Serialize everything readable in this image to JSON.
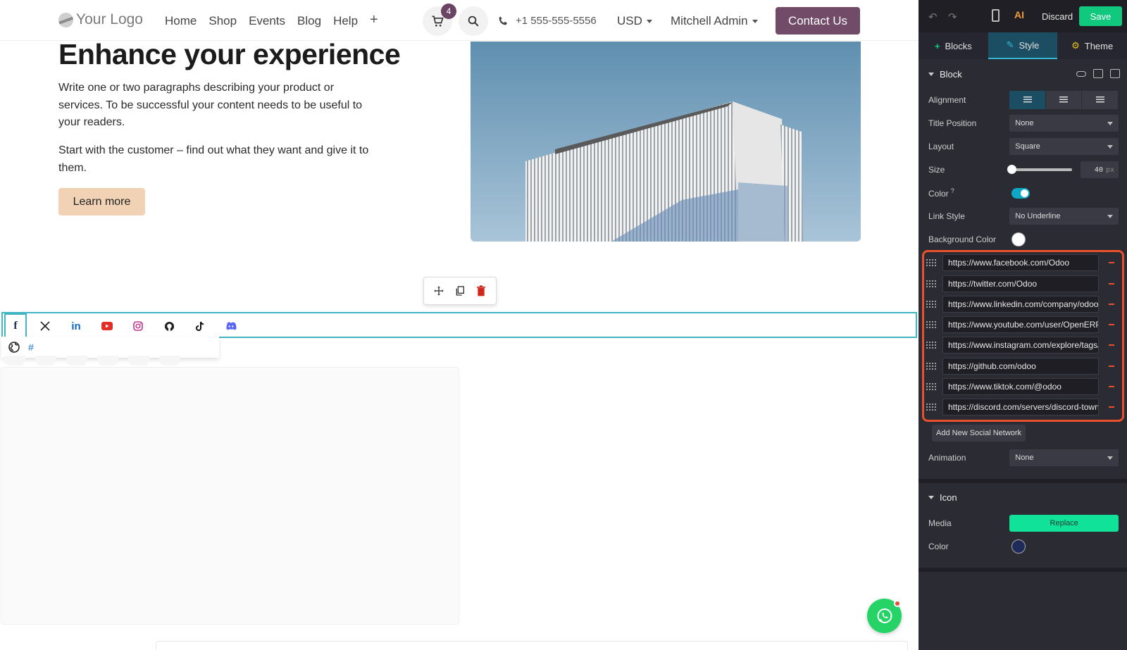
{
  "navbar": {
    "logo_text": "Your Logo",
    "menu": [
      "Home",
      "Shop",
      "Events",
      "Blog",
      "Help"
    ],
    "plus": "+",
    "cart_count": "4",
    "phone": "+1 555-555-5556",
    "currency": "USD",
    "user": "Mitchell Admin",
    "contact_label": "Contact Us"
  },
  "hero": {
    "title": "Enhance your experience",
    "paragraph1": "Write one or two paragraphs describing your product or services. To be successful your content needs to be useful to your readers.",
    "paragraph2": "Start with the customer – find out what they want and give it to them.",
    "button_label": "Learn more"
  },
  "social": {
    "icons": [
      "facebook-icon",
      "x-twitter-icon",
      "linkedin-icon",
      "youtube-icon",
      "instagram-icon",
      "github-icon",
      "tiktok-icon",
      "discord-icon"
    ],
    "dropdown_hash": "#"
  },
  "editor": {
    "discard_label": "Discard",
    "save_label": "Save",
    "tabs": [
      "Blocks",
      "Style",
      "Theme"
    ],
    "active_tab": "Style",
    "block_section": "Block",
    "options": {
      "alignment_label": "Alignment",
      "title_position_label": "Title Position",
      "title_position_value": "None",
      "layout_label": "Layout",
      "layout_value": "Square",
      "size_label": "Size",
      "size_value": "40",
      "size_unit": "px",
      "color_label": "Color",
      "color_help": "?",
      "color_enabled": true,
      "link_style_label": "Link Style",
      "link_style_value": "No Underline",
      "bg_color_label": "Background Color",
      "animation_label": "Animation",
      "animation_value": "None"
    },
    "links": [
      "https://www.facebook.com/Odoo",
      "https://twitter.com/Odoo",
      "https://www.linkedin.com/company/odoo",
      "https://www.youtube.com/user/OpenERPonline",
      "https://www.instagram.com/explore/tags/odoo/",
      "https://github.com/odoo",
      "https://www.tiktok.com/@odoo",
      "https://discord.com/servers/discord-town-hall"
    ],
    "add_network_label": "Add New Social Network",
    "icon_section": "Icon",
    "media_label": "Media",
    "replace_label": "Replace",
    "icon_color_label": "Color"
  },
  "colors": {
    "brand": "#714b67",
    "accent_teal": "#41b5c2",
    "highlight": "#e8512b",
    "save_green": "#10c97e",
    "icon_color": "#1c2b5a"
  }
}
